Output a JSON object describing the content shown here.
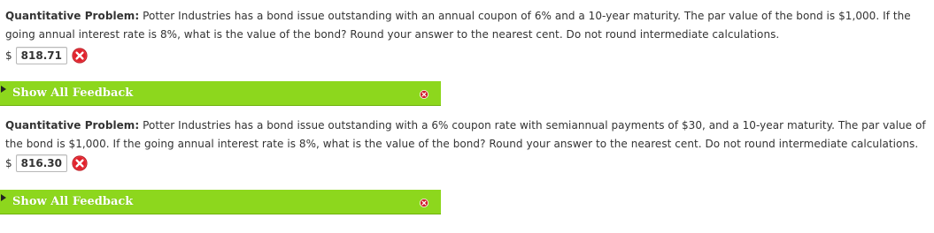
{
  "questions": [
    {
      "lead": "Quantitative Problem:",
      "line1": " Potter Industries has a bond issue outstanding with an annual coupon of 6% and a 10-year maturity. The par value of the bond is $1,000. If the",
      "line2": "going annual interest rate is 8%, what is the value of the bond? Round your answer to the nearest cent. Do not round intermediate calculations.",
      "currency": "$",
      "answer": "818.71",
      "status_icon": "wrong-x-icon",
      "feedback_label": "Show All Feedback",
      "feedback_icon": "close-x-icon"
    },
    {
      "lead": "Quantitative Problem:",
      "line1": " Potter Industries has a bond issue outstanding with a 6% coupon rate with semiannual payments of $30, and a 10-year maturity. The par value of",
      "line2": "the bond is $1,000. If the going annual interest rate is 8%, what is the value of the bond? Round your answer to the nearest cent. Do not round intermediate calculations.",
      "currency": "$",
      "answer": "816.30",
      "status_icon": "wrong-x-icon",
      "feedback_label": "Show All Feedback",
      "feedback_icon": "close-x-icon"
    }
  ],
  "colors": {
    "feedback_bar": "#8dd71d",
    "wrong_red": "#e0212b",
    "text": "#333333"
  }
}
